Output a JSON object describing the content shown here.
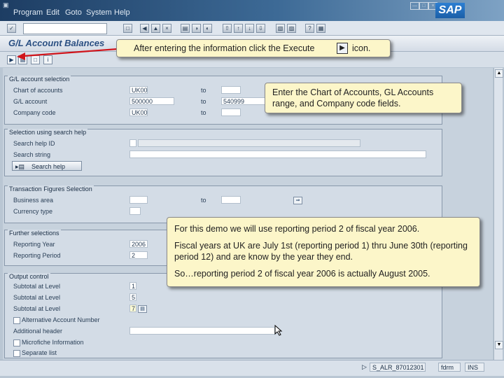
{
  "window": {
    "system_icon": "sap-system-icon",
    "menu": [
      "Program",
      "Edit",
      "Goto",
      "System",
      "Help"
    ],
    "brand": "SAP",
    "controls": [
      "minimize-icon",
      "maximize-icon",
      "close-icon"
    ]
  },
  "toolbar": {
    "command_field_value": "",
    "icons": [
      "enter-icon",
      "save-icon",
      "back-icon",
      "exit-icon",
      "cancel-icon",
      "print-icon",
      "find-icon",
      "find-next-icon",
      "first-page-icon",
      "prev-page-icon",
      "next-page-icon",
      "last-page-icon",
      "new-session-icon",
      "shortcut-icon",
      "help-icon",
      "layout-icon"
    ]
  },
  "screen_title": "G/L Account Balances",
  "app_toolbar": {
    "icons": [
      "execute-icon",
      "get-variant-icon",
      "save-variant-icon",
      "info-icon"
    ]
  },
  "sections": {
    "gl_selection": {
      "title": "G/L account selection",
      "rows": [
        {
          "label": "Chart of accounts",
          "from": "UK00",
          "to_label": "",
          "to": ""
        },
        {
          "label": "G/L account",
          "from": "500000",
          "to_label": "to",
          "to": "540999"
        },
        {
          "label": "Company code",
          "from": "UK00",
          "to_label": "to",
          "to": ""
        }
      ],
      "first_to_label": "to"
    },
    "search_help": {
      "title": "Selection using search help",
      "rows": [
        {
          "label": "Search help ID",
          "value": ""
        },
        {
          "label": "Search string",
          "value": ""
        }
      ],
      "button": "Search help"
    },
    "transaction": {
      "title": "Transaction Figures Selection",
      "rows": [
        {
          "label": "Business area",
          "value": "",
          "to_label": "to",
          "to": ""
        },
        {
          "label": "Currency type",
          "value": ""
        }
      ]
    },
    "further": {
      "title": "Further selections",
      "rows": [
        {
          "label": "Reporting Year",
          "value": "2006"
        },
        {
          "label": "Reporting Period",
          "value": "2"
        }
      ]
    },
    "output": {
      "title": "Output control",
      "rows": [
        {
          "label": "Subtotal at Level",
          "value": "1"
        },
        {
          "label": "Subtotal at Level",
          "value": "5"
        },
        {
          "label": "Subtotal at Level",
          "value": "7"
        }
      ],
      "checkboxes": [
        {
          "label": "Alternative Account Number",
          "checked": false
        },
        {
          "label": "Microfiche Information",
          "checked": false
        },
        {
          "label": "Separate list",
          "checked": false
        }
      ],
      "additional_header_label": "Additional header",
      "additional_header_value": ""
    }
  },
  "status_bar": {
    "system": "S_ALR_87012301",
    "server": "fdrm",
    "mode": "INS"
  },
  "callouts": {
    "execute": {
      "before": "After entering the information click the Execute",
      "after": "icon."
    },
    "fields": "Enter the Chart of Accounts, GL Accounts range, and Company code fields.",
    "period": [
      "For this demo we will use reporting period 2 of fiscal year 2006.",
      "Fiscal years at UK are July 1st (reporting period 1) thru June 30th (reporting period 12) and are know by the year they end.",
      "So…reporting period 2 of fiscal year 2006 is actually August 2005."
    ]
  },
  "colors": {
    "callout_bg": "#fcf6c9",
    "arrow": "#d0141b",
    "title": "#2a4f82"
  }
}
